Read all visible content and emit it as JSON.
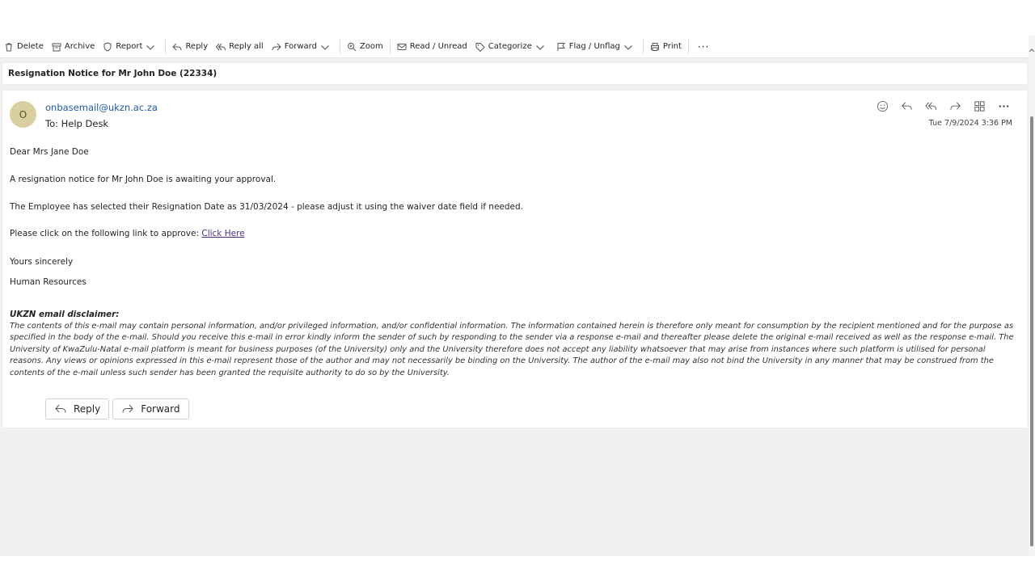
{
  "toolbar": {
    "delete": "Delete",
    "archive": "Archive",
    "report": "Report",
    "reply": "Reply",
    "reply_all": "Reply all",
    "forward": "Forward",
    "zoom": "Zoom",
    "read_unread": "Read / Unread",
    "categorize": "Categorize",
    "flag": "Flag / Unflag",
    "print": "Print",
    "more": "···"
  },
  "subject": "Resignation Notice for Mr John Doe (22334)",
  "message": {
    "avatar_initial": "O",
    "sender": "onbasemail@ukzn.ac.za",
    "to_prefix": "To:",
    "to": "Help Desk",
    "date": "Tue 7/9/2024 3:36 PM",
    "greeting": "Dear Mrs Jane Doe",
    "line1": "A resignation notice for Mr John Doe is awaiting your approval.",
    "line2": "The Employee has selected their Resignation Date as 31/03/2024 - please adjust it using the waiver date field if needed.",
    "line3_prefix": "Please click on the following link to approve:",
    "link_text": "Click Here",
    "closing": "Yours sincerely",
    "signature": "Human Resources",
    "disclaimer_title": "UKZN email disclaimer:",
    "disclaimer": "The contents of this e-mail may contain personal information, and/or privileged information, and/or confidential information. The information contained herein is therefore only meant for consumption by the recipient mentioned and for the purpose as specified in the body of the e-mail. Should you receive this e-mail in error kindly inform the sender of such by responding to the sender via a response e-mail and thereafter please delete the original e-mail received as well as the response e-mail. The University of KwaZulu-Natal e-mail platform is meant for business purposes (of the University) only and the University therefore does not accept any liability whatsoever that may arise from instances where such platform is utilised for personal reasons. Any views or opinions expressed in this e-mail represent those of the author and may not necessarily be binding on the University. The author of the e-mail may also not bind the University in any manner that may be construed from the contents of the e-mail unless such sender has been granted the requisite authority to do so by the University."
  },
  "buttons": {
    "reply": "Reply",
    "forward": "Forward"
  },
  "icons": {
    "delete": "trash-icon",
    "archive": "archive-icon",
    "report": "shield-icon",
    "reply": "reply-icon",
    "reply_all": "reply-all-icon",
    "forward": "forward-icon",
    "zoom": "zoom-icon",
    "read_unread": "envelope-icon",
    "categorize": "tag-icon",
    "flag": "flag-icon",
    "print": "printer-icon",
    "emoji": "emoji-icon",
    "apps": "apps-icon",
    "more": "more-icon"
  },
  "colors": {
    "sender_link": "#1f5a9e",
    "body_link": "#4b2e83",
    "avatar_bg": "#d9cfa0",
    "pane_bg": "#f0f0f0"
  }
}
